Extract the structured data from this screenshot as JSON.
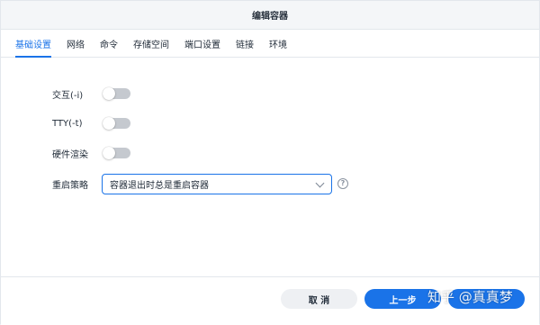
{
  "dialog": {
    "title": "编辑容器"
  },
  "tabs": [
    {
      "label": "基础设置",
      "active": true
    },
    {
      "label": "网络"
    },
    {
      "label": "命令"
    },
    {
      "label": "存储空间"
    },
    {
      "label": "端口设置"
    },
    {
      "label": "链接"
    },
    {
      "label": "环境"
    }
  ],
  "form": {
    "interactive": {
      "label": "交互(-i)",
      "enabled": false
    },
    "tty": {
      "label": "TTY(-t)",
      "enabled": false
    },
    "hw_render": {
      "label": "硬件渲染",
      "enabled": false
    },
    "restart_policy": {
      "label": "重启策略",
      "selected": "容器退出时总是重启容器",
      "help_icon": "?"
    }
  },
  "footer": {
    "cancel_label": "取 消",
    "prev_label": "上一步"
  },
  "watermark": "知乎 @真真梦",
  "colors": {
    "accent": "#1a73e8",
    "toggle_off": "#c5c9cf"
  }
}
